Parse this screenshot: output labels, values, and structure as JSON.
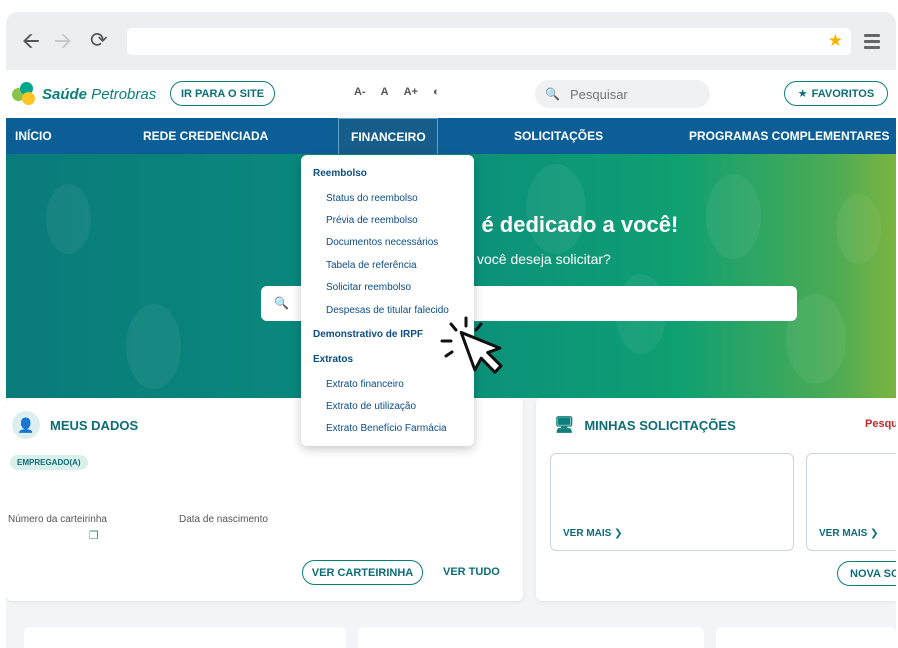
{
  "browser": {
    "back_icon": "arrow-left-icon",
    "forward_icon": "arrow-right-icon",
    "reload_icon": "reload-icon",
    "bookmark_icon": "star-icon",
    "menu_icon": "hamburger-menu-icon"
  },
  "header": {
    "logo_bold": "Saúde",
    "logo_rest": " Petrobras",
    "ir_para_o_site": "IR PARA O SITE",
    "font_decrease": "A-",
    "font_normal": "A",
    "font_increase": "A+",
    "contrast_icon": "contrast-icon",
    "search_placeholder": "Pesquisar",
    "favoritos": "FAVORITOS"
  },
  "nav": {
    "items": [
      "INÍCIO",
      "REDE CREDENCIADA",
      "FINANCEIRO",
      "SOLICITAÇÕES",
      "PROGRAMAS COMPLEMENTARES"
    ],
    "active": "FINANCEIRO"
  },
  "hero": {
    "title": "al é dedicado a você!",
    "subtitle": "você deseja solicitar?"
  },
  "dropdown": {
    "sections": [
      {
        "heading": "Reembolso",
        "items": [
          "Status do reembolso",
          "Prévia de reembolso",
          "Documentos necessários",
          "Tabela de referência",
          "Solicitar reembolso",
          "Despesas de titular falecido"
        ]
      },
      {
        "heading": "Demonstrativo de IRPF",
        "items": []
      },
      {
        "heading": "Extratos",
        "items": [
          "Extrato financeiro",
          "Extrato de utilização",
          "Extrato Benefício Farmácia"
        ]
      }
    ]
  },
  "meus_dados": {
    "title": "MEUS DADOS",
    "badge": "EMPREGADO(A)",
    "numero_label": "Número da carteirinha",
    "nascimento_label": "Data de nascimento",
    "ver_carteirinha": "VER CARTEIRINHA",
    "ver_tudo": "VER TUDO"
  },
  "minhas_solicitacoes": {
    "title": "MINHAS SOLICITAÇÕES",
    "pesq": "Pesqu",
    "ver_mais": "VER MAIS",
    "nova": "NOVA SO"
  },
  "colors": {
    "nav_blue": "#0b5f96",
    "teal": "#0d7f7a",
    "dropdown_text": "#0b4d86",
    "red_link": "#c2272d"
  }
}
